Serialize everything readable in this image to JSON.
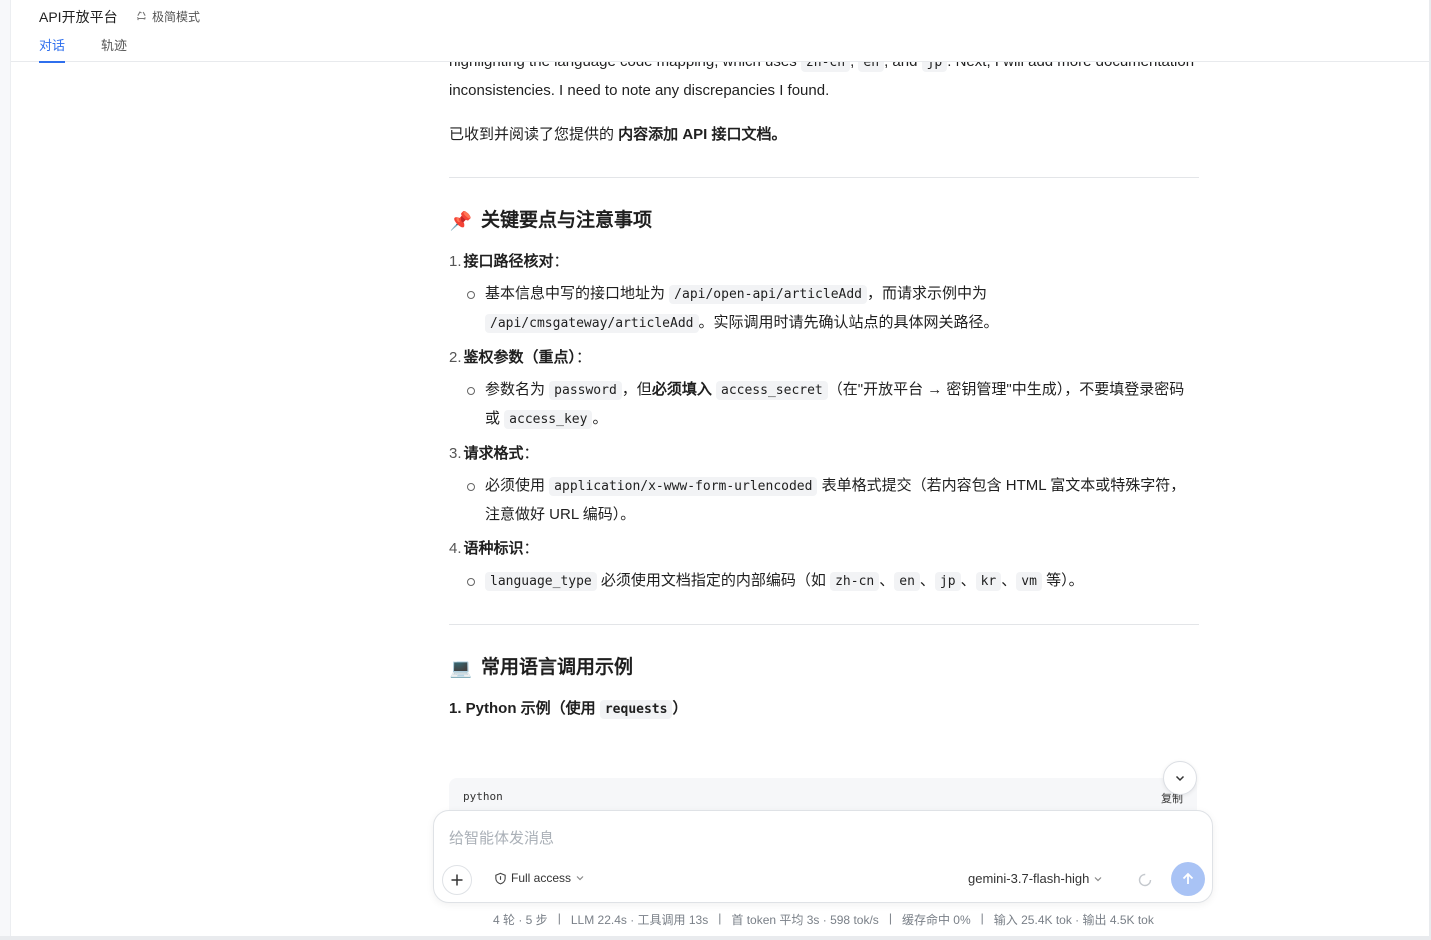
{
  "header": {
    "title": "API开放平台",
    "mode_label": "极简模式",
    "tabs": [
      {
        "label": "对话",
        "active": true
      },
      {
        "label": "轨迹",
        "active": false
      }
    ]
  },
  "message": {
    "intro_lines": [
      "highlighting the language code mapping, which uses",
      "zh-cn",
      ",",
      "en",
      ", and",
      "jp",
      ". Next, I will add more documentation inconsistencies. I need to note any discrepancies I found."
    ],
    "received_prefix": "已收到并阅读了您提供的 ",
    "received_bold": "内容添加 API 接口文档。",
    "section1": {
      "emoji": "📌",
      "title": "关键要点与注意事项",
      "items": [
        {
          "num": "1.",
          "title": "接口路径核对",
          "suffix": "：",
          "sub_a": "基本信息中写的接口地址为 ",
          "code_a": "/api/open-api/articleAdd",
          "sub_b": "，而请求示例中为 ",
          "code_b": "/api/cmsgateway/articleAdd",
          "sub_c": "。实际调用时请先确认站点的具体网关路径。"
        },
        {
          "num": "2.",
          "title": "鉴权参数（重点）",
          "suffix": "：",
          "sub_a": "参数名为 ",
          "code_a": "password",
          "sub_b": "，但",
          "bold_b": "必须填入",
          "code_b": "access_secret",
          "sub_c": "（在\"开放平台 → 密钥管理\"中生成），不要填登录密码或 ",
          "code_c": "access_key",
          "sub_d": "。"
        },
        {
          "num": "3.",
          "title": "请求格式",
          "suffix": "：",
          "sub_a": "必须使用 ",
          "code_a": "application/x-www-form-urlencoded",
          "sub_b": " 表单格式提交（若内容包含 HTML 富文本或特殊字符，注意做好 URL 编码）。"
        },
        {
          "num": "4.",
          "title": "语种标识",
          "suffix": "：",
          "code_a": "language_type",
          "sub_a": " 必须使用文档指定的内部编码（如 ",
          "codes": [
            "zh-cn",
            "en",
            "jp",
            "kr",
            "vm"
          ],
          "sep": "、",
          "sub_b": " 等）。"
        }
      ]
    },
    "section2": {
      "emoji": "💻",
      "title": "常用语言调用示例",
      "example_prefix": "1. Python 示例（使用 ",
      "example_code": "requests",
      "example_suffix": "）"
    },
    "code_block": {
      "language": "python",
      "copy_label": "复制"
    }
  },
  "composer": {
    "placeholder": "给智能体发消息",
    "access_label": "Full access",
    "model_label": "gemini-3.7-flash-high"
  },
  "status": {
    "rounds": "4 轮 · 5 步",
    "timing": "LLM 22.4s · 工具调用 13s",
    "first_token": "首 token 平均 3s · 598 tok/s",
    "cache": "缓存命中 0%",
    "tokens": "输入 25.4K tok · 输出 4.5K tok",
    "separator": "|"
  },
  "colors": {
    "accent": "#2f6fed",
    "send_button": "#a9c3f5",
    "code_bg": "#f2f3f5"
  }
}
